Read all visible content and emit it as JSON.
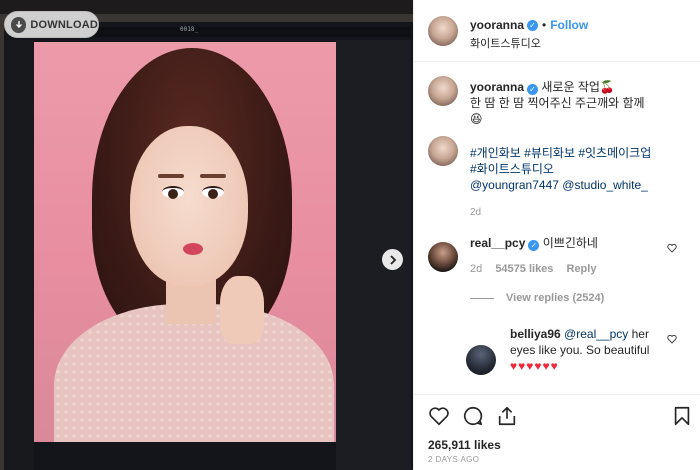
{
  "photo": {
    "download_label": "DOWNLOAD",
    "monitor_caption": "0018_"
  },
  "post": {
    "username": "yooranna",
    "follow_label": "Follow",
    "location": "화이트스튜디오"
  },
  "caption": {
    "username": "yooranna",
    "line1": "새로운 작업🍒",
    "line2": "한 땀 한 땀 찍어주신 주근깨와 함께",
    "line3": "😆",
    "hashtags_line1": "#개인화보 #뷰티화보 #잇츠메이크업",
    "hashtags_line2": "#화이트스튜디오",
    "mention1": "@youngran7447",
    "mention2": "@studio_white_",
    "age": "2d"
  },
  "comments": [
    {
      "username": "real__pcy",
      "text": "이쁘긴하네",
      "age": "2d",
      "likes": "54575 likes",
      "reply_label": "Reply",
      "view_replies": "View replies (2524)"
    }
  ],
  "reply": {
    "username": "belliya96",
    "mention": "@real__pcy",
    "text_part1": "her",
    "text_part2": "eyes like you. So beautiful",
    "hearts": "♥♥♥♥♥♥"
  },
  "footer": {
    "likes": "265,911 likes",
    "timestamp": "2 DAYS AGO"
  },
  "colors": {
    "accent": "#3897f0",
    "heart": "#ed2a3a",
    "link": "#003569"
  }
}
